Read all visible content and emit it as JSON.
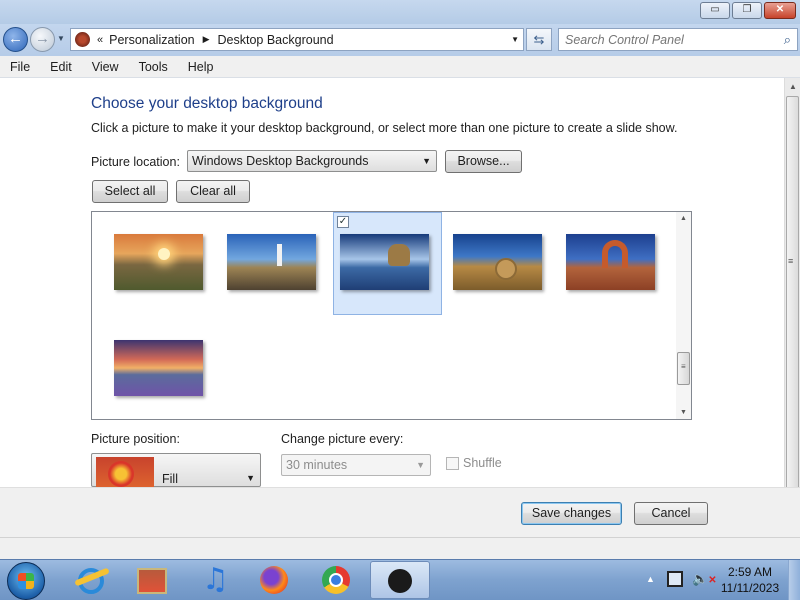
{
  "window": {
    "buttons": {
      "minimize": "▭",
      "maximize": "❐",
      "close": "✕"
    }
  },
  "navigation": {
    "back_icon": "back-arrow-icon",
    "forward_icon": "forward-arrow-icon",
    "breadcrumb_chevron": "«",
    "breadcrumb": [
      "Personalization",
      "Desktop Background"
    ],
    "refresh_icon": "refresh-icon",
    "search_placeholder": "Search Control Panel"
  },
  "menu": [
    "File",
    "Edit",
    "View",
    "Tools",
    "Help"
  ],
  "page": {
    "heading": "Choose your desktop background",
    "description": "Click a picture to make it your desktop background, or select more than one picture to create a slide show.",
    "picture_location_label": "Picture location:",
    "picture_location_value": "Windows Desktop Backgrounds",
    "browse_label": "Browse...",
    "select_all_label": "Select all",
    "clear_all_label": "Clear all",
    "gallery": {
      "tiles": [
        {
          "name": "sunset-mountains",
          "selected": false
        },
        {
          "name": "lighthouse-coast",
          "selected": false
        },
        {
          "name": "lake-rock",
          "selected": true
        },
        {
          "name": "hay-bale",
          "selected": false
        },
        {
          "name": "delicate-arch",
          "selected": false
        },
        {
          "name": "lupine-lake",
          "selected": false
        }
      ]
    },
    "picture_position_label": "Picture position:",
    "picture_position_value": "Fill",
    "change_every_label": "Change picture every:",
    "change_every_value": "30 minutes",
    "shuffle_label": "Shuffle"
  },
  "footer": {
    "save_label": "Save changes",
    "cancel_label": "Cancel"
  },
  "taskbar": {
    "pinned": [
      "windows-start-icon",
      "internet-explorer-icon",
      "store-icon",
      "itunes-icon",
      "firefox-icon",
      "chrome-icon",
      "control-panel-icon"
    ],
    "clock_time": "2:59 AM",
    "clock_date": "11/11/2023"
  },
  "colors": {
    "heading": "#1e3f8a",
    "selection": "#d7e7fb",
    "taskbar": "#7ea2cf"
  }
}
